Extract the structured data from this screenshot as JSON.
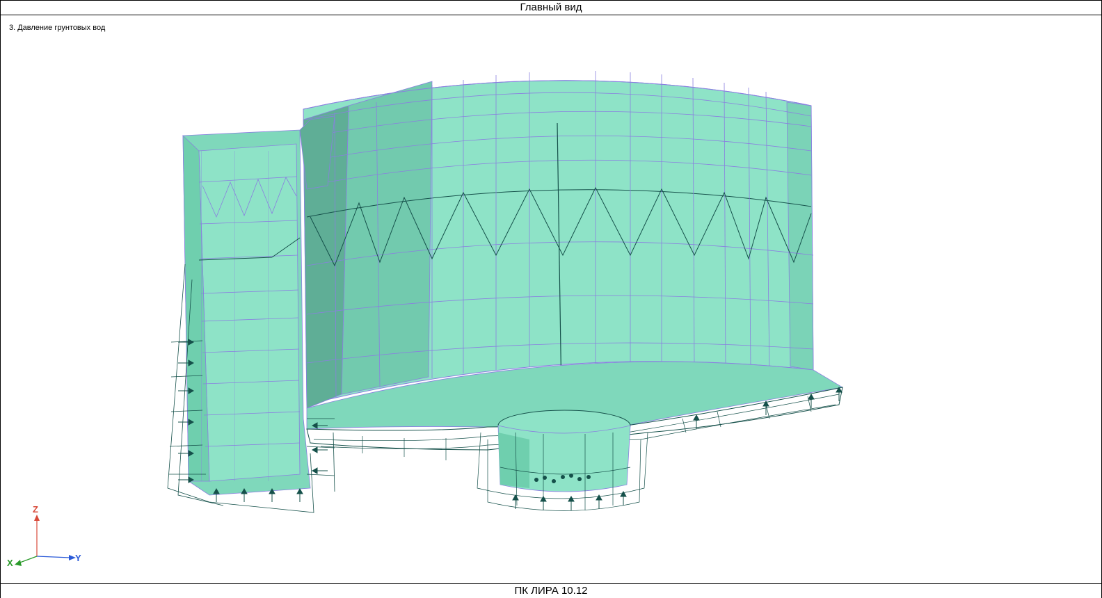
{
  "window": {
    "title": "Главный вид",
    "footer": "ПК ЛИРА 10.12"
  },
  "viewport": {
    "load_case_label": "3. Давление грунтовых вод"
  },
  "axes": {
    "x_label": "X",
    "y_label": "Y",
    "z_label": "Z",
    "x_color": "#2a9a2a",
    "y_color": "#2a5ad8",
    "z_color": "#d84a3a"
  },
  "colors": {
    "surface": "#8ee3c7",
    "surface_dark": "#6fcfae",
    "surface_shadow": "#4f9c86",
    "mesh": "#8a7fe0",
    "load_lines": "#15504a"
  }
}
